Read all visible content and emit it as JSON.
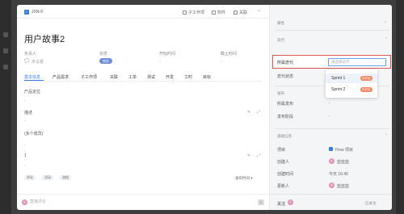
{
  "header": {
    "item_key": "JXN-9",
    "actions": [
      "子工作项",
      "附件",
      "关联"
    ]
  },
  "title": "用户故事2",
  "fields": {
    "owner_label": "负责人",
    "owner_value": "未设置",
    "status_label": "状态",
    "status_value": "待办",
    "start_label": "开始时间",
    "start_value": "-",
    "end_label": "截止时间",
    "end_value": "-"
  },
  "tabs": [
    "基本信息",
    "产品需求",
    "子工作项",
    "关联",
    "工单",
    "测试",
    "开发",
    "工时",
    "目标"
  ],
  "sections": {
    "product_unit_label": "产品定位",
    "product_unit_value": "-",
    "description_label": "描述",
    "description_value": "-",
    "multi_select_label": "(多个成员)",
    "multi_select_value": "-",
    "num_label": "1",
    "num_value": "-"
  },
  "tags": [
    "评论",
    "活动",
    "流程"
  ],
  "sort_label": "发布时间",
  "comment": {
    "avatar_text": "蓝",
    "placeholder": "直接评论",
    "send_label": "发"
  },
  "right": {
    "section1": "属性",
    "section2": "迭代",
    "sprint_label": "所属迭代",
    "sprint_placeholder": "请选择迭代",
    "sprint_state_label": "迭代状态",
    "section3": "发布",
    "release_label": "所属发布",
    "release_value": "-",
    "release_stage_label": "发布阶段",
    "release_stage_value": "-",
    "section4": "基础信息",
    "project_label": "项目",
    "project_value": "Flow 项目",
    "creator_label": "创建人",
    "creator_value": "蓝蓝蓝",
    "created_label": "创建时间",
    "created_value": "今天 16:45",
    "updater_label": "更新人",
    "updater_value": "蓝蓝蓝",
    "footer_follow": "关注",
    "footer_right": "已关注"
  },
  "dropdown": [
    {
      "name": "Sprint 1",
      "badge": "未开始"
    },
    {
      "name": "Sprint 2",
      "badge": "未开始"
    }
  ]
}
